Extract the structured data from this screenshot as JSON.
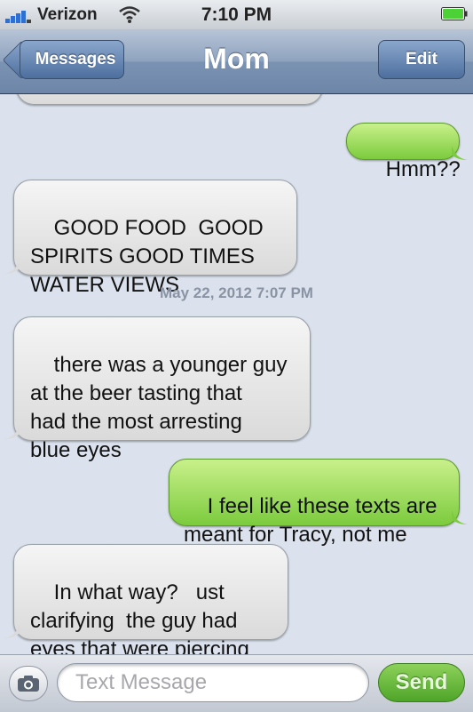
{
  "status_bar": {
    "carrier": "Verizon",
    "time": "7:10 PM",
    "signal_icon": "signal-bars-icon",
    "wifi_icon": "wifi-icon",
    "battery_icon": "battery-icon",
    "signal_color": "#2f6fd1",
    "battery_color": "#4cd137"
  },
  "nav": {
    "title": "Mom",
    "back_label": "Messages",
    "edit_label": "Edit"
  },
  "conversation": {
    "messages": [
      {
        "direction": "in",
        "text": "",
        "partial": true
      },
      {
        "direction": "out",
        "text": "Hmm??"
      },
      {
        "direction": "in",
        "text": "GOOD FOOD  GOOD\nSPIRITS GOOD TIMES\nWATER VIEWS"
      },
      {
        "direction": "in",
        "text": "there was a younger guy\nat the beer tasting that\nhad the most arresting\nblue eyes"
      },
      {
        "direction": "out",
        "text": "I feel like these texts are\nmeant for Tracy, not me"
      },
      {
        "direction": "in",
        "text": "In what way?   ust\nclarifying  the guy had\neyes that were piercing"
      }
    ],
    "timestamp": "May 22, 2012 7:07 PM"
  },
  "input_bar": {
    "camera_icon": "camera-icon",
    "placeholder": "Text Message",
    "send_label": "Send"
  },
  "colors": {
    "outgoing_bubble": "#7bcb3d",
    "incoming_bubble": "#e6e6e6",
    "background": "#dbe2ed"
  }
}
